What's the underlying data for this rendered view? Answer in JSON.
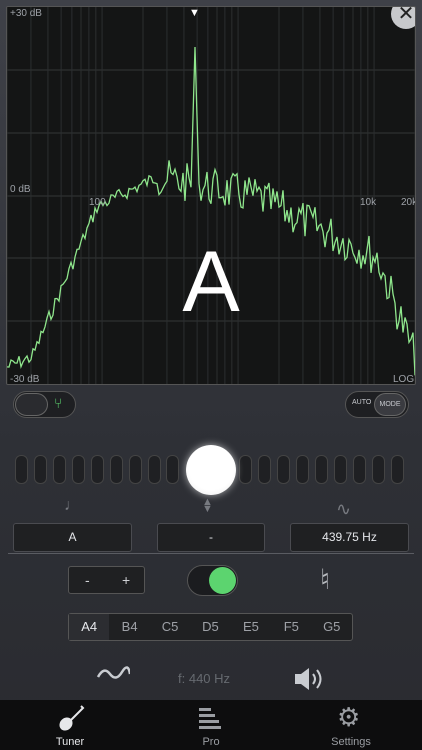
{
  "spectrum": {
    "y_top_label": "+30 dB",
    "y_mid_label": "0 dB",
    "y_bottom_label": "-30 dB",
    "x_labels": [
      "100",
      "10k",
      "20k"
    ],
    "scale_label": "LOG",
    "note": "A",
    "line_color": "#8fe68c"
  },
  "controls": {
    "auto_label": "AUTO",
    "mode_label": "MODE"
  },
  "readouts": {
    "note_value": "A",
    "cents_value": "-",
    "frequency_value": "439.75 Hz"
  },
  "stepper": {
    "minus": "-",
    "plus": "+"
  },
  "accidental": "♮",
  "strings": [
    "A4",
    "B4",
    "C5",
    "D5",
    "E5",
    "F5",
    "G5"
  ],
  "selected_string": "A4",
  "reference": "f: 440 Hz",
  "tabs": [
    {
      "label": "Tuner",
      "icon": "guitar-icon"
    },
    {
      "label": "Pro",
      "icon": "bars-icon"
    },
    {
      "label": "Settings",
      "icon": "gear-icon"
    }
  ],
  "accent_color": "#5cd46f"
}
